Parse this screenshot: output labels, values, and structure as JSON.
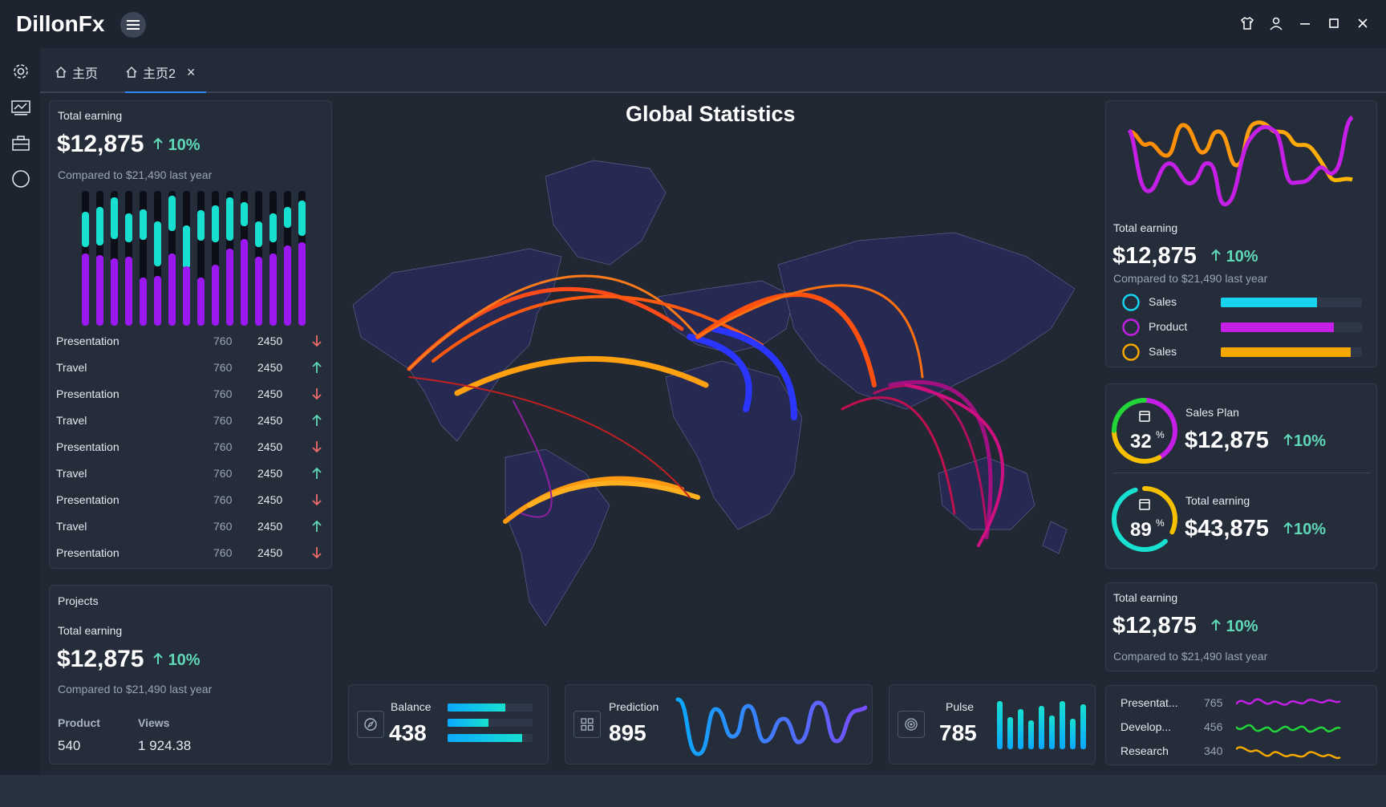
{
  "app": {
    "title": "DillonFx"
  },
  "tabs": [
    {
      "label": "主页"
    },
    {
      "label": "主页2",
      "close": "×"
    }
  ],
  "left_card": {
    "label": "Total earning",
    "value": "$12,875",
    "change": "10%",
    "compare": "Compared to $21,490 last year",
    "rows": [
      {
        "name": "Presentation",
        "a": "760",
        "b": "2450",
        "trend": "down"
      },
      {
        "name": "Travel",
        "a": "760",
        "b": "2450",
        "trend": "up"
      },
      {
        "name": "Presentation",
        "a": "760",
        "b": "2450",
        "trend": "down"
      },
      {
        "name": "Travel",
        "a": "760",
        "b": "2450",
        "trend": "up"
      },
      {
        "name": "Presentation",
        "a": "760",
        "b": "2450",
        "trend": "down"
      },
      {
        "name": "Travel",
        "a": "760",
        "b": "2450",
        "trend": "up"
      },
      {
        "name": "Presentation",
        "a": "760",
        "b": "2450",
        "trend": "down"
      },
      {
        "name": "Travel",
        "a": "760",
        "b": "2450",
        "trend": "up"
      },
      {
        "name": "Presentation",
        "a": "760",
        "b": "2450",
        "trend": "down"
      }
    ]
  },
  "projects_card": {
    "title": "Projects",
    "label": "Total earning",
    "value": "$12,875",
    "change": "10%",
    "compare": "Compared to $21,490 last year",
    "product_label": "Product",
    "product_value": "540",
    "views_label": "Views",
    "views_value": "1 924.38"
  },
  "map": {
    "title": "Global Statistics"
  },
  "balance": {
    "label": "Balance",
    "value": "438",
    "bars": [
      0.68,
      0.48,
      0.88
    ]
  },
  "prediction": {
    "label": "Prediction",
    "value": "895"
  },
  "pulse": {
    "label": "Pulse",
    "value": "785"
  },
  "right_top": {
    "label": "Total earning",
    "value": "$12,875",
    "change": "10%",
    "compare": "Compared to $21,490 last year",
    "legend": [
      {
        "name": "Sales",
        "color": "#17d4f0",
        "level": 0.68
      },
      {
        "name": "Product",
        "color": "#c51ee6",
        "level": 0.8
      },
      {
        "name": "Sales",
        "color": "#f6a800",
        "level": 0.92
      }
    ]
  },
  "right_rings": [
    {
      "label": "Sales Plan",
      "value": "$12,875",
      "change": "10%",
      "percent": "32",
      "pct_sign": "%"
    },
    {
      "label": "Total earning",
      "value": "$43,875",
      "change": "10%",
      "percent": "89",
      "pct_sign": "%"
    }
  ],
  "right_bottom": {
    "label": "Total earning",
    "value": "$12,875",
    "change": "10%",
    "compare": "Compared to $21,490 last year"
  },
  "mini_stats": [
    {
      "name": "Presentat...",
      "value": "765",
      "color": "#c51ee6"
    },
    {
      "name": "Develop...",
      "value": "456",
      "color": "#22d63a"
    },
    {
      "name": "Research",
      "value": "340",
      "color": "#f6a800"
    }
  ],
  "colors": {
    "accent_up": "#5fd8b8",
    "accent_down": "#ef6b6b",
    "cyan": "#17e0d0",
    "purple": "#9b19f0"
  }
}
